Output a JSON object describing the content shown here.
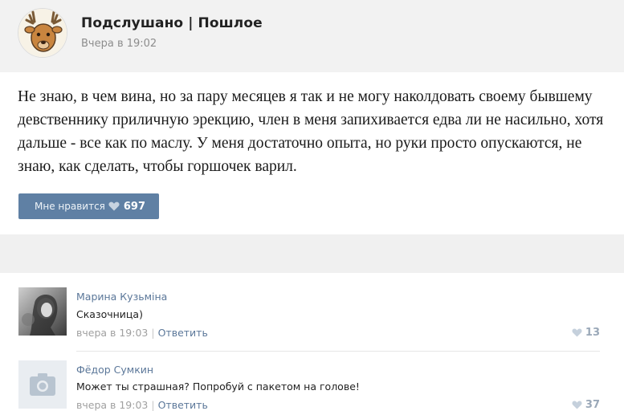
{
  "post": {
    "group_name": "Подслушано | Пошлое",
    "time": "Вчера в 19:02",
    "text": "Не знаю, в чем вина, но за пару месяцев я так и не могу наколдовать своему бывшему девственнику приличную эрекцию, член в меня запихивается едва ли не насильно, хотя дальше - все как по маслу. У меня достаточно опыта, но руки просто опускаются, не знаю, как сделать, чтобы горшочек варил.",
    "like_label": "Мне нравится",
    "like_count": "697"
  },
  "comments": [
    {
      "author": "Марина Кузьміна",
      "text": "Сказочница)",
      "time": "вчера в 19:03",
      "reply": "Ответить",
      "likes": "13"
    },
    {
      "author": "Фёдор Сумкин",
      "text": "Может ты страшная? Попробуй с пакетом на голове!",
      "time": "вчера в 19:03",
      "reply": "Ответить",
      "likes": "37"
    }
  ],
  "colors": {
    "accent": "#5f80a4",
    "link": "#5b7799",
    "heart": "#9aa8b8"
  }
}
